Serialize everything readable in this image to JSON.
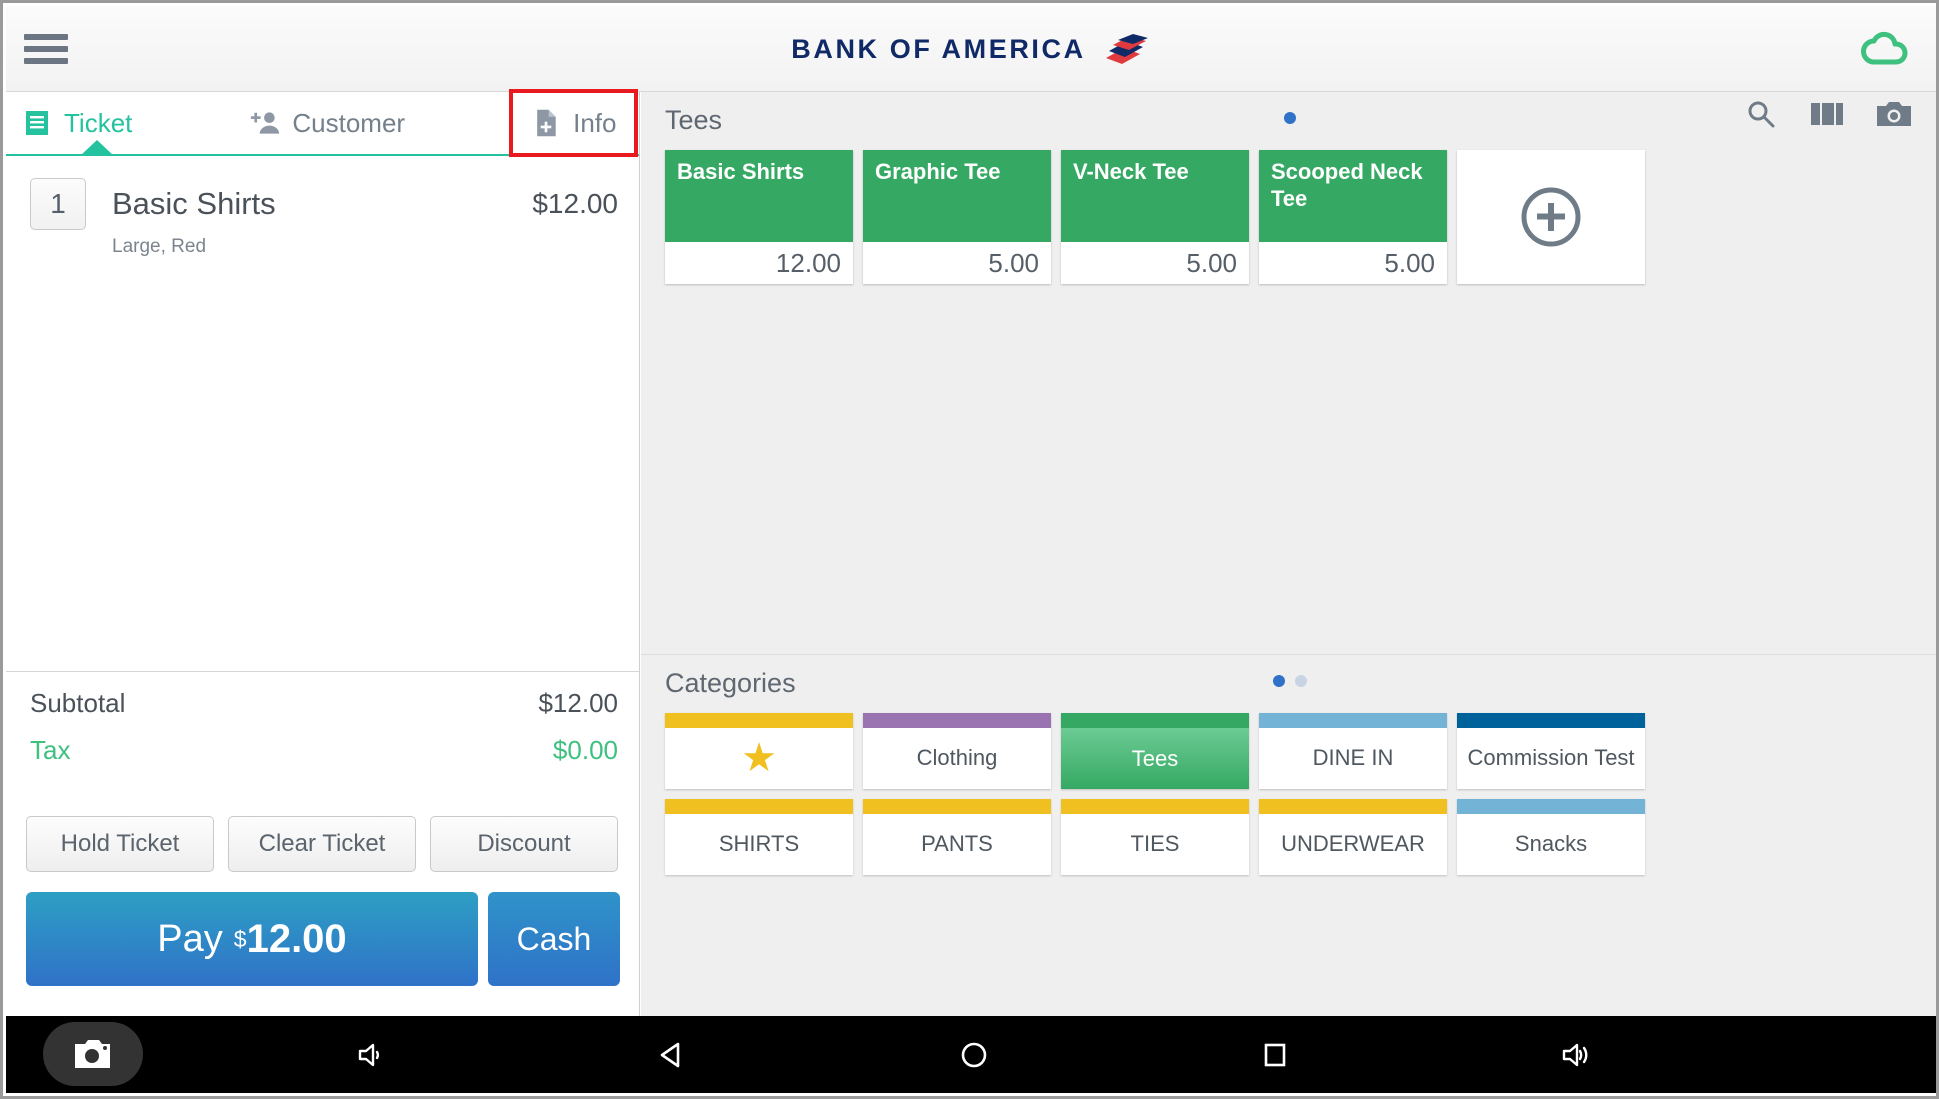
{
  "appbar": {
    "menu_icon": "hamburger-menu-icon",
    "brand_text": "BANK OF AMERICA",
    "brand_flag_icon": "bank-of-america-flag-icon",
    "cloud_icon": "cloud-icon",
    "brand_navy": "#102a67",
    "brand_red": "#e03a3e",
    "cloud_green": "#3ec07f"
  },
  "ticket": {
    "tabs": [
      {
        "label": "Ticket",
        "icon": "receipt-icon",
        "selected": true
      },
      {
        "label": "Customer",
        "icon": "add-person-icon",
        "selected": false
      },
      {
        "label": "Info",
        "icon": "note-add-icon",
        "selected": false,
        "highlighted": true
      }
    ],
    "highlight_color": "#e8191f",
    "accent_color": "#25c2a0",
    "lines": [
      {
        "qty": "1",
        "name": "Basic Shirts",
        "modifier": "Large, Red",
        "price": "$12.00"
      }
    ],
    "totals": [
      {
        "label": "Subtotal",
        "value": "$12.00",
        "style": "normal"
      },
      {
        "label": "Tax",
        "value": "$0.00",
        "style": "tax"
      }
    ],
    "actions": [
      {
        "label": "Hold Ticket"
      },
      {
        "label": "Clear Ticket"
      },
      {
        "label": "Discount"
      }
    ],
    "pay": {
      "label": "Pay",
      "currency": "$",
      "amount": "12.00"
    },
    "cash": {
      "label": "Cash"
    }
  },
  "catalog": {
    "products_section": {
      "title": "Tees",
      "pager": {
        "count": 1,
        "active": 0
      },
      "icons": [
        {
          "name": "search-icon"
        },
        {
          "name": "view-columns-icon"
        },
        {
          "name": "camera-icon"
        }
      ],
      "tiles": [
        {
          "name": "Basic Shirts",
          "price": "12.00",
          "color": "#35a963"
        },
        {
          "name": "Graphic Tee",
          "price": "5.00",
          "color": "#35a963"
        },
        {
          "name": "V-Neck Tee",
          "price": "5.00",
          "color": "#35a963"
        },
        {
          "name": "Scooped Neck Tee",
          "price": "5.00",
          "color": "#35a963"
        }
      ],
      "add_tile": {
        "icon": "plus-circle-icon"
      }
    },
    "categories_section": {
      "title": "Categories",
      "pager": {
        "count": 2,
        "active": 0
      },
      "tiles": [
        {
          "label": "",
          "icon": "star-icon",
          "color": "#f0c020",
          "selected": false
        },
        {
          "label": "Clothing",
          "color": "#9a74b0",
          "selected": false
        },
        {
          "label": "Tees",
          "color": "#35a963",
          "selected": true
        },
        {
          "label": "DINE IN",
          "color": "#72b3d6",
          "selected": false
        },
        {
          "label": "Commission Test",
          "color": "#00629b",
          "selected": false
        },
        {
          "label": "SHIRTS",
          "color": "#f0c020",
          "selected": false
        },
        {
          "label": "PANTS",
          "color": "#f0c020",
          "selected": false
        },
        {
          "label": "TIES",
          "color": "#f0c020",
          "selected": false
        },
        {
          "label": "UNDERWEAR",
          "color": "#f0c020",
          "selected": false
        },
        {
          "label": "Snacks",
          "color": "#72b3d6",
          "selected": false
        }
      ]
    }
  },
  "navbar": {
    "camera_button_icon": "screenshot-camera-icon",
    "keys": [
      {
        "name": "volume-down-icon"
      },
      {
        "name": "back-icon"
      },
      {
        "name": "home-icon"
      },
      {
        "name": "recents-icon"
      },
      {
        "name": "volume-up-icon"
      }
    ]
  }
}
